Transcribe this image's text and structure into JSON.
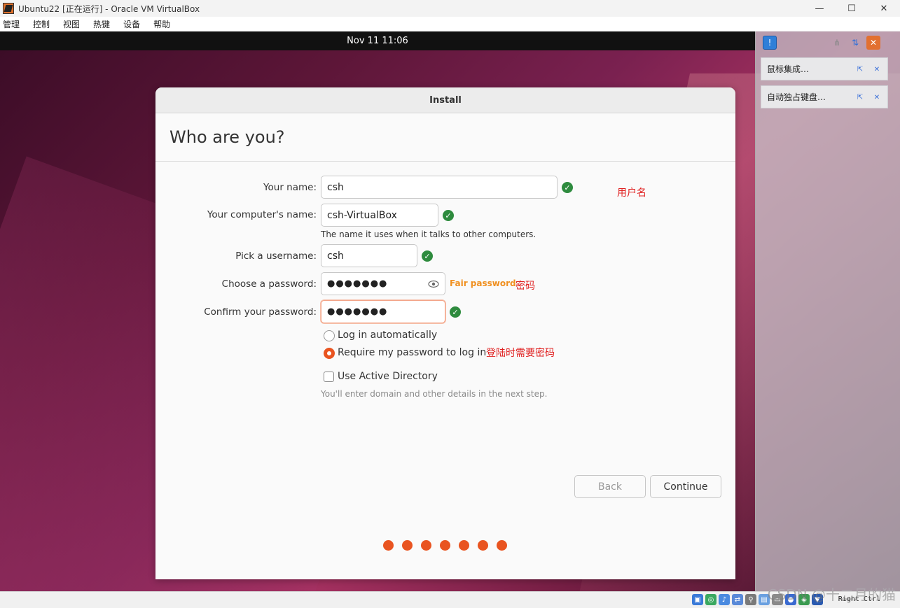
{
  "window": {
    "title": "Ubuntu22 [正在运行] - Oracle VM VirtualBox",
    "controls": {
      "minimize": "—",
      "maximize": "☐",
      "close": "✕"
    }
  },
  "menubar": {
    "items": [
      "管理",
      "控制",
      "视图",
      "热键",
      "设备",
      "帮助"
    ]
  },
  "guest": {
    "clock": "Nov 11  11:06"
  },
  "installer": {
    "window_title": "Install",
    "page_title": "Who are you?",
    "fields": {
      "name_label": "Your name:",
      "name_value": "csh",
      "computer_label": "Your computer's name:",
      "computer_value": "csh-VirtualBox",
      "computer_hint": "The name it uses when it talks to other computers.",
      "username_label": "Pick a username:",
      "username_value": "csh",
      "password_label": "Choose a password:",
      "password_value": "●●●●●●●",
      "password_strength": "Fair password",
      "confirm_label": "Confirm your password:",
      "confirm_value": "●●●●●●●"
    },
    "options": {
      "auto_login": "Log in automatically",
      "require_password": "Require my password to log in",
      "selected": "require_password",
      "active_directory": "Use Active Directory",
      "active_directory_checked": false,
      "ad_hint": "You'll enter domain and other details in the next step."
    },
    "buttons": {
      "back": "Back",
      "continue": "Continue"
    },
    "progress_steps": 7
  },
  "annotations": {
    "username": "用户名",
    "password": "密码",
    "login": "登陆时需要密码"
  },
  "vbox_panel": {
    "notifications": [
      "鼠标集成…",
      "自动独占键盘…"
    ]
  },
  "statusbar": {
    "host_key": "Right Ctrl",
    "watermark": "CSDN @十二月的猫"
  },
  "colors": {
    "accent": "#e95420",
    "check": "#2e8b3e",
    "strength": "#f09020",
    "annotation": "#e02020"
  }
}
